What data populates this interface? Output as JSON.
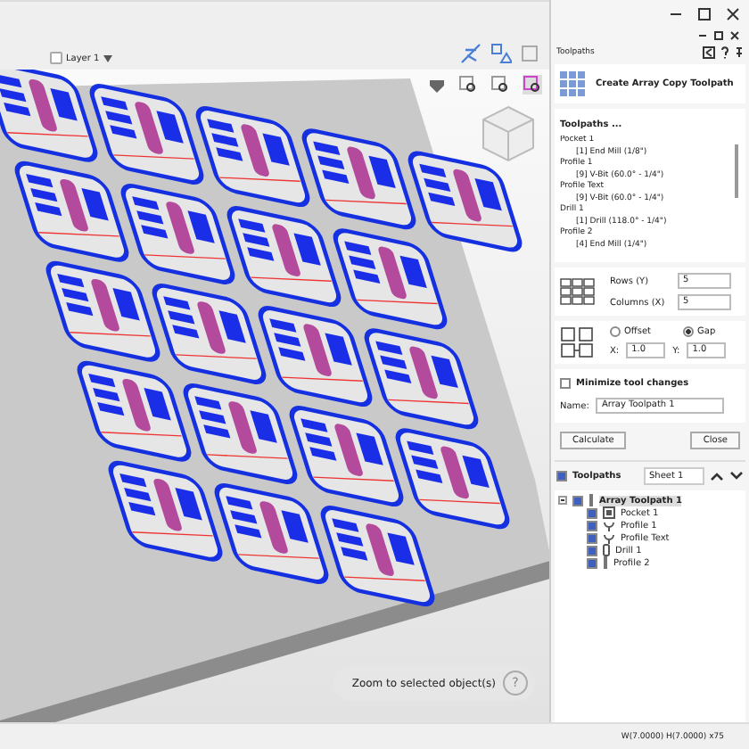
{
  "layer_selector": {
    "label": "Layer 1"
  },
  "viewport": {
    "hint": "Zoom to selected object(s)",
    "help": "?"
  },
  "panel": {
    "title": "Toolpaths",
    "heading": "Create Array Copy Toolpath",
    "list_title": "Toolpaths ...",
    "list_lines": [
      "Pocket 1",
      "[1] End Mill (1/8\")",
      "Profile 1",
      "[9] V-Bit (60.0° - 1/4\")",
      "Profile Text",
      "[9] V-Bit (60.0° - 1/4\")",
      "Drill 1",
      "[1] Drill (118.0° - 1/4\")",
      "Profile 2",
      "[4] End Mill (1/4\")"
    ],
    "rows": {
      "label": "Rows (Y)",
      "value": "5"
    },
    "columns": {
      "label": "Columns (X)",
      "value": "5"
    },
    "spacing": [
      {
        "label": "Offset",
        "selected": false
      },
      {
        "label": "Gap",
        "selected": true
      }
    ],
    "x": {
      "label": "X:",
      "value": "1.0"
    },
    "y": {
      "label": "Y:",
      "value": "1.0"
    },
    "minimize": {
      "label": "Minimize tool changes",
      "checked": false
    },
    "name": {
      "label": "Name:",
      "value": "Array Toolpath 1"
    },
    "buttons": [
      "Calculate",
      "Close"
    ]
  },
  "toolpaths": {
    "title": "Toolpaths",
    "checked": true,
    "sheet": "Sheet 1",
    "tree": [
      {
        "label": "Array Toolpath 1",
        "kind": "array",
        "checked": true,
        "expanded": true,
        "selected": true,
        "children": [
          {
            "label": "Pocket 1",
            "kind": "pocket",
            "checked": true,
            "selected": false
          },
          {
            "label": "Profile 1",
            "kind": "profile",
            "checked": true,
            "selected": false
          },
          {
            "label": "Profile Text",
            "kind": "profile",
            "checked": true,
            "selected": false
          },
          {
            "label": "Drill 1",
            "kind": "drill",
            "checked": true,
            "selected": false
          },
          {
            "label": "Profile 2",
            "kind": "array",
            "checked": true,
            "selected": false
          }
        ]
      }
    ]
  },
  "status_bar": "W(7.0000) H(7.0000) x75"
}
